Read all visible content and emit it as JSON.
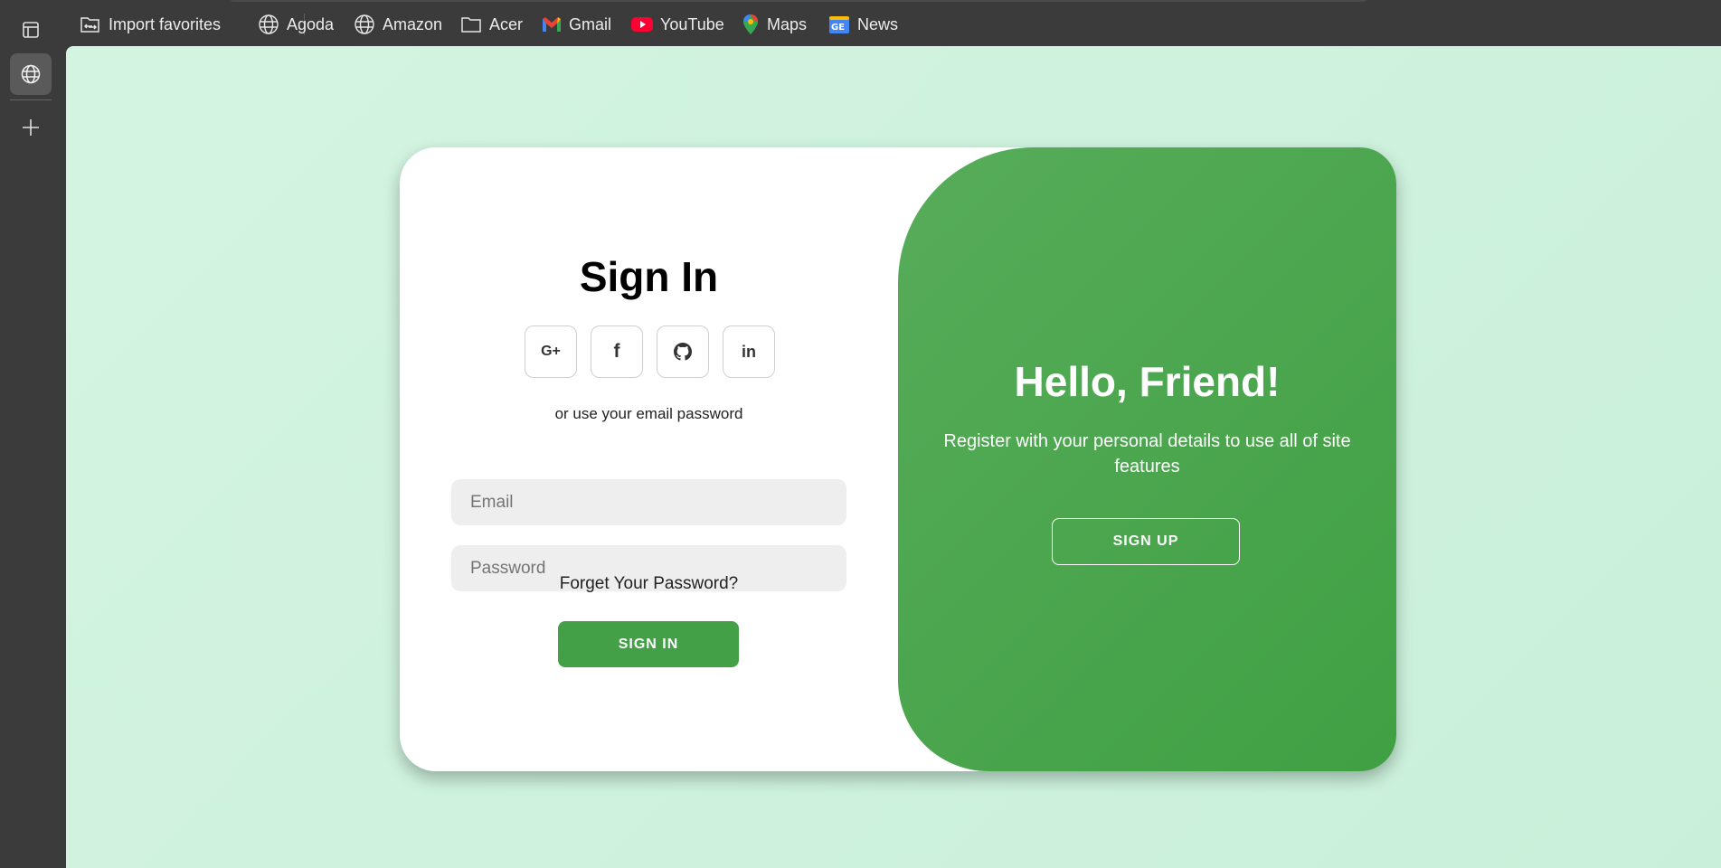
{
  "browser": {
    "favorites": [
      {
        "label": "Import favorites",
        "icon": "import-folder-icon"
      },
      {
        "label": "Agoda",
        "icon": "globe-icon"
      },
      {
        "label": "Amazon",
        "icon": "globe-icon"
      },
      {
        "label": "Acer",
        "icon": "folder-icon"
      },
      {
        "label": "Gmail",
        "icon": "gmail-icon"
      },
      {
        "label": "YouTube",
        "icon": "youtube-icon"
      },
      {
        "label": "Maps",
        "icon": "maps-pin-icon"
      },
      {
        "label": "News",
        "icon": "news-icon"
      }
    ],
    "sidebar_icons": [
      "tab-actions-icon",
      "globe-icon",
      "plus-icon"
    ]
  },
  "signin": {
    "title": "Sign In",
    "social": [
      {
        "label": "G+",
        "icon": "google-plus-icon"
      },
      {
        "label": "f",
        "icon": "facebook-icon"
      },
      {
        "label": "",
        "icon": "github-icon"
      },
      {
        "label": "in",
        "icon": "linkedin-icon"
      }
    ],
    "hint": "or use your email password",
    "email_placeholder": "Email",
    "password_placeholder": "Password",
    "forgot": "Forget Your Password?",
    "button": "SIGN IN"
  },
  "panel": {
    "title": "Hello, Friend!",
    "text": "Register with your personal details to use all of site features",
    "button": "SIGN UP"
  },
  "colors": {
    "accent": "#43a047",
    "background": "#cdf1dd",
    "chrome": "#3b3b3b"
  }
}
